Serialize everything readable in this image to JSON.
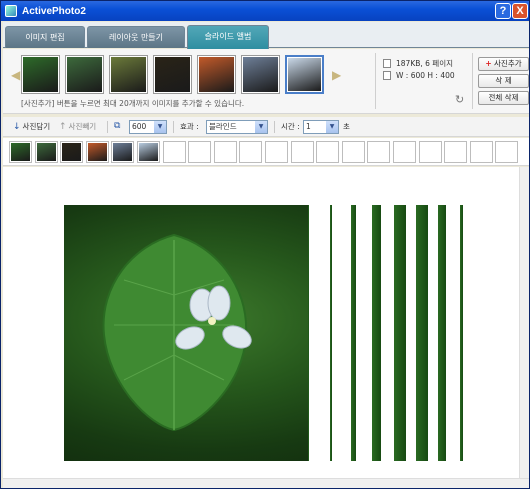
{
  "window": {
    "title": "ActivePhoto2",
    "help_label": "?",
    "close_label": "X"
  },
  "tabs": [
    {
      "label": "이미지 편집",
      "active": false
    },
    {
      "label": "레이아웃 만들기",
      "active": false
    },
    {
      "label": "슬라이드 앨범",
      "active": true
    }
  ],
  "gallery": {
    "hint": "[사진추가] 버튼을 누르면 최대 20개까지 이미지를 추가할 수 있습니다.",
    "thumbnails": [
      {
        "name": "leaf-green",
        "color": "#2e6b2a"
      },
      {
        "name": "forest-road",
        "color": "#3d6a3c"
      },
      {
        "name": "garden-path",
        "color": "#6b7a3a"
      },
      {
        "name": "night-lights",
        "color": "#2a2418"
      },
      {
        "name": "sunset",
        "color": "#c25a2a"
      },
      {
        "name": "temple",
        "color": "#6e7f98"
      },
      {
        "name": "white-flowers",
        "color": "#c9d8e8"
      }
    ],
    "selected_index": 6
  },
  "info": {
    "size": "187KB, 6 페이지",
    "dimensions": "W : 600   H : 400"
  },
  "side_buttons": {
    "add": "사진추가",
    "delete": "삭 제",
    "delete_all": "전체 삭제"
  },
  "toolbar": {
    "load_label": "사진담기",
    "save_label": "사진빼기",
    "size_value": "600",
    "effect_label": "효과 :",
    "effect_value": "블라인드",
    "time_label": "시간 :",
    "time_value": "1",
    "time_unit": "초"
  },
  "strip": {
    "slot_count": 20,
    "filled": [
      {
        "color": "#2e6b2a"
      },
      {
        "color": "#3d6a3c"
      },
      {
        "color": "#2a2418"
      },
      {
        "color": "#c25a2a"
      },
      {
        "color": "#6e7f98"
      },
      {
        "color": "#b8cce0"
      }
    ]
  },
  "colors": {
    "accent": "#2f8ea1",
    "title_bar": "#0a50d6",
    "tab_inactive": "#6a8394"
  }
}
